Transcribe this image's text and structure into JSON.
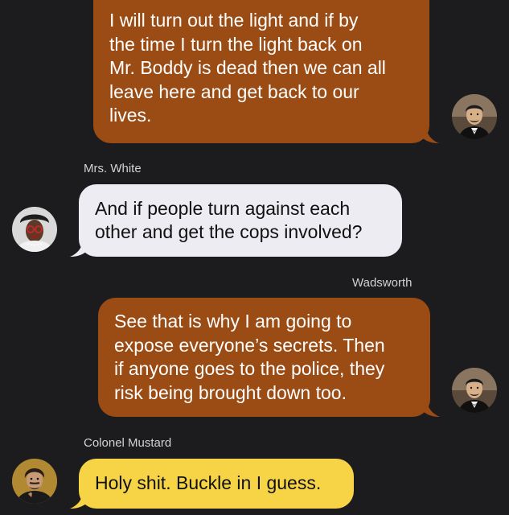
{
  "messages": [
    {
      "sender": "",
      "text": "I will turn out the light and if by\nthe time I turn the light back on\nMr. Boddy is dead then we can all\nleave here and get back to our\nlives.",
      "direction": "outgoing",
      "avatar": "wadsworth-avatar",
      "color": "#9b4b14"
    },
    {
      "sender": "Mrs. White",
      "text": "And if people turn against each\nother and get the cops involved?",
      "direction": "incoming",
      "avatar": "mrs-white-avatar",
      "color": "#ececf2"
    },
    {
      "sender": "Wadsworth",
      "text": "See that is why I am going to\nexpose everyone’s secrets. Then\nif anyone goes to the police, they\nrisk being brought down too.",
      "direction": "outgoing",
      "avatar": "wadsworth-avatar",
      "color": "#9b4b14"
    },
    {
      "sender": "Colonel Mustard",
      "text": "Holy shit. Buckle in I guess.",
      "direction": "incoming",
      "avatar": "colonel-mustard-avatar",
      "color": "#f6d446"
    }
  ]
}
